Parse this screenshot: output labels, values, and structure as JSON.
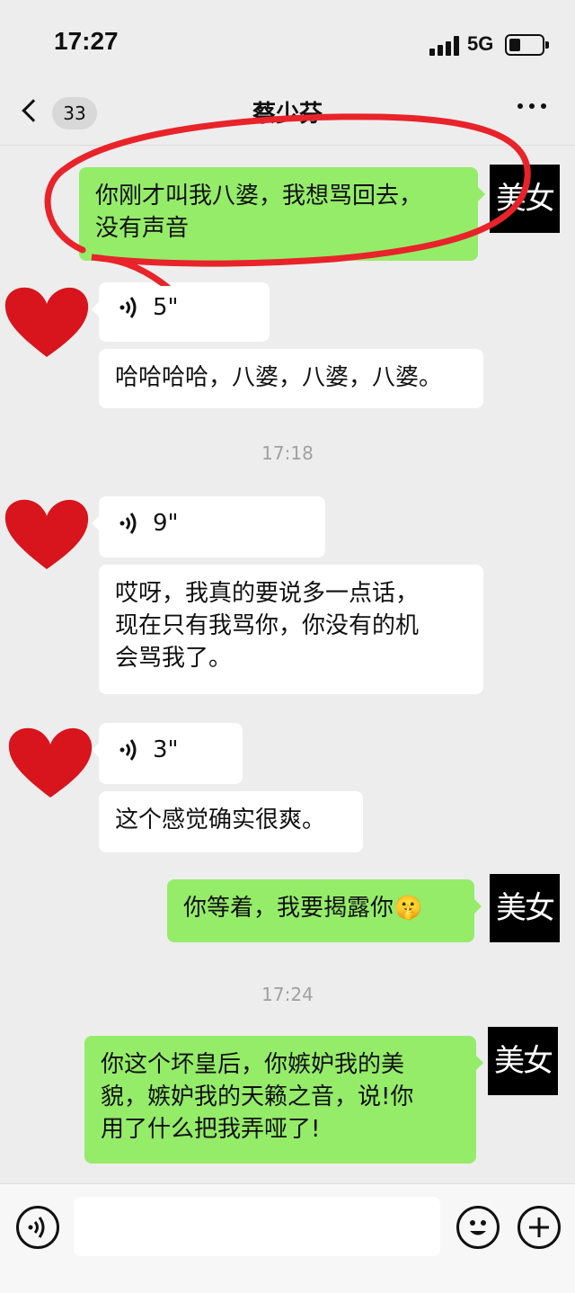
{
  "status": {
    "time": "17:27",
    "network": "5G"
  },
  "nav": {
    "back_count": "33",
    "title": "蔡少芬"
  },
  "avatar_self_label": "美女",
  "messages": {
    "m1": "你刚才叫我八婆，我想骂回去，\n没有声音",
    "m2_voice": "5\"",
    "m3": "哈哈哈哈，八婆，八婆，八婆。",
    "t1": "17:18",
    "m4_voice": "9\"",
    "m5": "哎呀，我真的要说多一点话，\n现在只有我骂你，你没有的机\n会骂我了。",
    "m6_voice": "3\"",
    "m7": "这个感觉确实很爽。",
    "m8": "你等着，我要揭露你🤫",
    "t2": "17:24",
    "m9": "你这个坏皇后，你嫉妒我的美\n貌，嫉妒我的天籁之音，说!你\n用了什么把我弄哑了!"
  },
  "colors": {
    "bubble_out": "#95ec69",
    "bubble_in": "#ffffff",
    "annotation": "#e8232a",
    "heart": "#d8141c"
  },
  "icons": {
    "back": "chevron-left-icon",
    "more": "more-dots-icon",
    "voice": "voice-icon",
    "emoji": "emoji-icon",
    "add": "plus-icon",
    "avatar_in": "heart-avatar"
  }
}
